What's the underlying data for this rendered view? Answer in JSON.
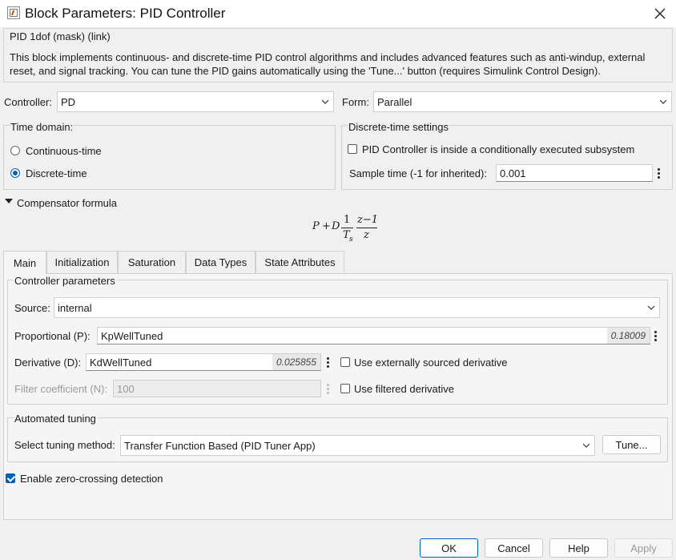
{
  "window": {
    "title": "Block Parameters: PID Controller",
    "close_icon": "close-icon"
  },
  "mask": {
    "title": "PID 1dof (mask) (link)",
    "description": "This block implements continuous- and discrete-time PID control algorithms and includes advanced features such as anti-windup, external reset, and signal tracking. You can tune the PID gains automatically using the 'Tune...' button (requires Simulink Control Design)."
  },
  "controller": {
    "label": "Controller:",
    "value": "PD"
  },
  "form": {
    "label": "Form:",
    "value": "Parallel"
  },
  "time_domain": {
    "title": "Time domain:",
    "options": [
      "Continuous-time",
      "Discrete-time"
    ],
    "selected": "Discrete-time"
  },
  "discrete_settings": {
    "title": "Discrete-time settings",
    "subsystem_label": "PID Controller is inside a conditionally executed subsystem",
    "subsystem_checked": false,
    "sample_time_label": "Sample time (-1 for inherited):",
    "sample_time_value": "0.001"
  },
  "compensator": {
    "label": "Compensator formula",
    "formula": {
      "p": "P",
      "plus": "+",
      "d": "D",
      "num1": "1",
      "den1": "T",
      "den1_sub": "s",
      "num2": "z−1",
      "den2": "z"
    }
  },
  "tabs": [
    "Main",
    "Initialization",
    "Saturation",
    "Data Types",
    "State Attributes"
  ],
  "active_tab": "Main",
  "controller_params": {
    "title": "Controller parameters",
    "source_label": "Source:",
    "source_value": "internal",
    "proportional_label": "Proportional (P):",
    "proportional_value": "KpWellTuned",
    "proportional_hint": "0.18009",
    "derivative_label": "Derivative (D):",
    "derivative_value": "KdWellTuned",
    "derivative_hint": "0.025855",
    "use_ext_derivative_label": "Use externally sourced derivative",
    "filter_label": "Filter coefficient (N):",
    "filter_value": "100",
    "use_filtered_label": "Use filtered derivative"
  },
  "automated_tuning": {
    "title": "Automated tuning",
    "method_label": "Select tuning method:",
    "method_value": "Transfer Function Based (PID Tuner App)",
    "tune_button": "Tune..."
  },
  "zero_crossing": {
    "label": "Enable zero-crossing detection",
    "checked": true
  },
  "buttons": {
    "ok": "OK",
    "cancel": "Cancel",
    "help": "Help",
    "apply": "Apply"
  },
  "colors": {
    "accent": "#005fb8",
    "background": "#f0f0f0"
  }
}
